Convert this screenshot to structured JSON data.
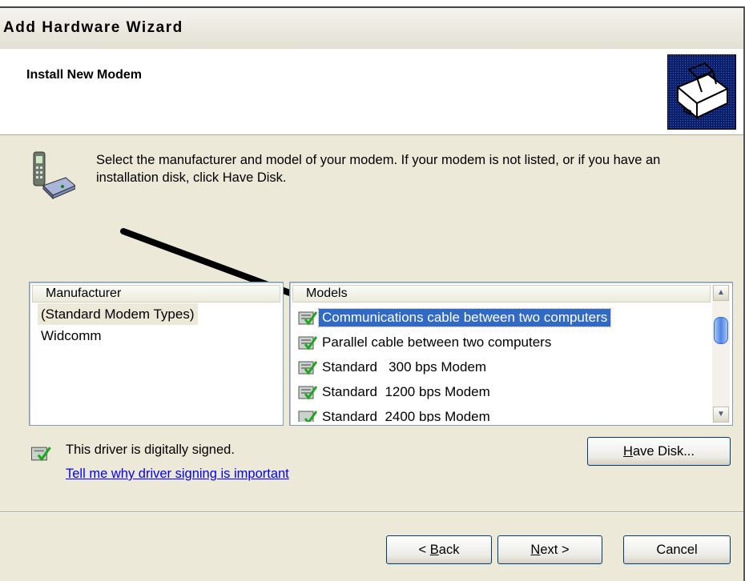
{
  "window": {
    "title": "Add Hardware Wizard",
    "top_strip_text": ""
  },
  "header": {
    "title": "Install New Modem",
    "icon": "hardware-wizard-icon"
  },
  "instruction": {
    "icon": "modem-phone-icon",
    "text": "Select the manufacturer and model of your modem. If your modem is not listed, or if you have an installation disk, click Have Disk."
  },
  "manufacturer_list": {
    "header": "Manufacturer",
    "items": [
      "(Standard Modem Types)",
      "Widcomm"
    ],
    "selected_index": 0
  },
  "models_list": {
    "header": "Models",
    "items": [
      "Communications cable between two computers",
      "Parallel cable between two computers",
      "Standard   300 bps Modem",
      "Standard  1200 bps Modem",
      "Standard  2400 bps Modem"
    ],
    "selected_index": 0,
    "item_icon": "signed-driver-icon"
  },
  "signing": {
    "icon": "signed-driver-icon",
    "text": "This driver is digitally signed.",
    "link": "Tell me why driver signing is important"
  },
  "buttons": {
    "have_disk_pre": "",
    "have_disk_key": "H",
    "have_disk_post": "ave Disk...",
    "back_pre": "< ",
    "back_key": "B",
    "back_post": "ack",
    "next_key": "N",
    "next_post": "ext >",
    "cancel": "Cancel"
  },
  "annotation": {
    "icon": "pointer-arrow-icon"
  },
  "colors": {
    "selection": "#316ac5",
    "link": "#0000ff",
    "dialog_bg": "#ece9d8"
  }
}
